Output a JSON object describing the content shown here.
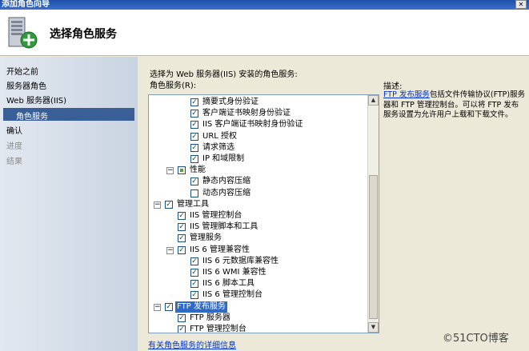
{
  "window": {
    "title": "添加角色向导",
    "close_glyph": "✕"
  },
  "header": {
    "title": "选择角色服务",
    "icon": "server-add-icon"
  },
  "sidebar": {
    "items": [
      {
        "label": "开始之前",
        "state": "normal"
      },
      {
        "label": "服务器角色",
        "state": "normal"
      },
      {
        "label": "Web 服务器(IIS)",
        "state": "normal"
      },
      {
        "label": "角色服务",
        "state": "selected"
      },
      {
        "label": "确认",
        "state": "normal"
      },
      {
        "label": "进度",
        "state": "disabled"
      },
      {
        "label": "结果",
        "state": "disabled"
      }
    ]
  },
  "main": {
    "intro": "选择为 Web 服务器(IIS) 安装的角色服务:",
    "services_label": "角色服务(R):",
    "tree": [
      {
        "label": "摘要式身份验证",
        "checked": "checked",
        "expander": ""
      },
      {
        "label": "客户端证书映射身份验证",
        "checked": "checked",
        "expander": ""
      },
      {
        "label": "IIS 客户端证书映射身份验证",
        "checked": "checked",
        "expander": ""
      },
      {
        "label": "URL 授权",
        "checked": "checked",
        "expander": ""
      },
      {
        "label": "请求筛选",
        "checked": "checked",
        "expander": ""
      },
      {
        "label": "IP 和域限制",
        "checked": "checked",
        "expander": ""
      },
      {
        "label": "性能",
        "checked": "partial",
        "expander": "⊟"
      },
      {
        "label": "静态内容压缩",
        "checked": "checked",
        "expander": ""
      },
      {
        "label": "动态内容压缩",
        "checked": "unchecked",
        "expander": ""
      },
      {
        "label": "管理工具",
        "checked": "checked",
        "expander": "⊟"
      },
      {
        "label": "IIS 管理控制台",
        "checked": "checked",
        "expander": ""
      },
      {
        "label": "IIS 管理脚本和工具",
        "checked": "checked",
        "expander": ""
      },
      {
        "label": "管理服务",
        "checked": "checked",
        "expander": ""
      },
      {
        "label": "IIS 6 管理兼容性",
        "checked": "checked",
        "expander": "⊟"
      },
      {
        "label": "IIS 6 元数据库兼容性",
        "checked": "checked",
        "expander": ""
      },
      {
        "label": "IIS 6 WMI 兼容性",
        "checked": "checked",
        "expander": ""
      },
      {
        "label": "IIS 6 脚本工具",
        "checked": "checked",
        "expander": ""
      },
      {
        "label": "IIS 6 管理控制台",
        "checked": "checked",
        "expander": ""
      },
      {
        "label": "FTP 发布服务",
        "checked": "checked",
        "expander": "⊟",
        "selected": true
      },
      {
        "label": "FTP 服务器",
        "checked": "checked",
        "expander": ""
      },
      {
        "label": "FTP 管理控制台",
        "checked": "checked",
        "expander": ""
      }
    ],
    "scroll_up_glyph": "▲",
    "scroll_down_glyph": "▼",
    "more_info_link": "有关角色服务的详细信息"
  },
  "description": {
    "title": "描述:",
    "link": "FTP 发布服务",
    "text": "包括文件传输协议(FTP)服务器和 FTP 管理控制台。可以将 FTP 发布服务设置为允许用户上载和下载文件。"
  },
  "watermark": "©51CTO博客",
  "colors": {
    "selection": "#316ac5",
    "nav_selected": "#3a5f96",
    "link": "#0033cc"
  }
}
